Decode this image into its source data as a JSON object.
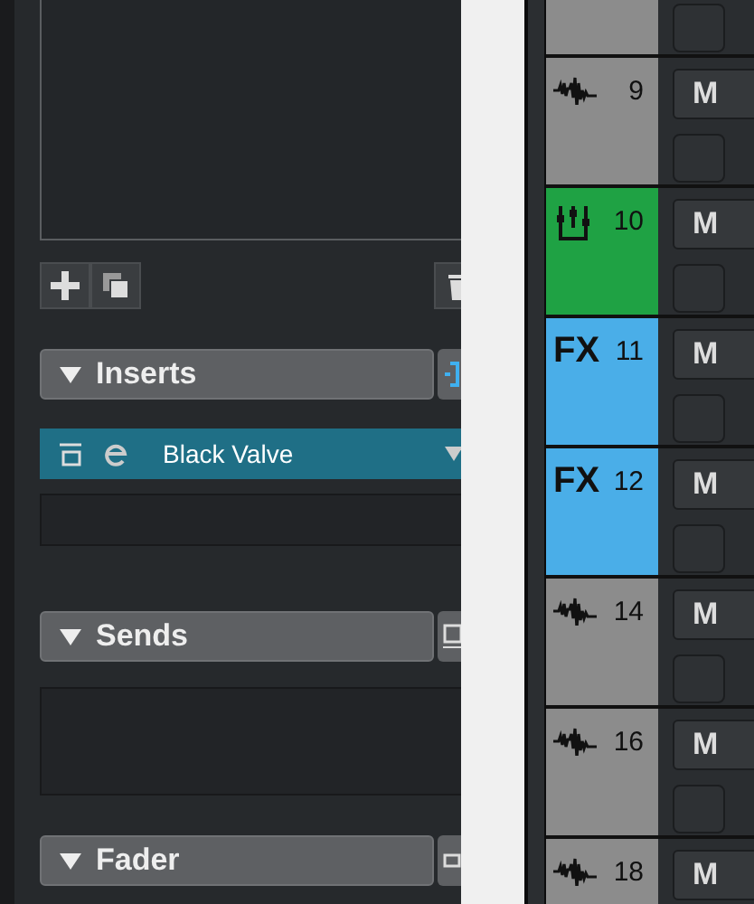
{
  "inspector": {
    "sections": [
      {
        "kind": "inserts",
        "title": "Inserts",
        "expanded": true,
        "slots": [
          {
            "kind": "plugin",
            "name": "Black Valve",
            "active": true
          },
          {
            "kind": "empty"
          }
        ]
      },
      {
        "kind": "sends",
        "title": "Sends",
        "expanded": true
      },
      {
        "kind": "fader",
        "title": "Fader",
        "expanded": true
      }
    ]
  },
  "tracks": [
    {
      "color": "#8c8c8c",
      "lower_button": true
    },
    {
      "kind": "audio",
      "number": "9",
      "color": "#8c8c8c",
      "mute": "M",
      "lower_button": true
    },
    {
      "kind": "instrument",
      "number": "10",
      "color": "#1fa244",
      "mute": "M",
      "lower_button": true
    },
    {
      "kind": "fx",
      "number": "11",
      "color": "#4aaee8",
      "mute": "M",
      "icon_text": "FX",
      "lower_button": true
    },
    {
      "kind": "fx",
      "number": "12",
      "color": "#4aaee8",
      "mute": "M",
      "icon_text": "FX",
      "lower_button": true
    },
    {
      "kind": "audio",
      "number": "14",
      "color": "#8c8c8c",
      "mute": "M",
      "lower_button": true
    },
    {
      "kind": "audio",
      "number": "16",
      "color": "#8c8c8c",
      "mute": "M",
      "lower_button": true
    },
    {
      "kind": "audio",
      "number": "18",
      "color": "#8c8c8c",
      "mute": "M"
    }
  ]
}
